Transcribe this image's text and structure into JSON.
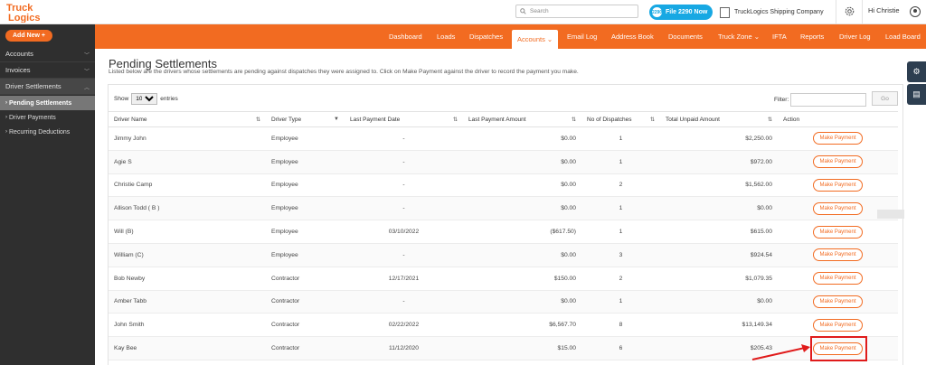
{
  "topbar": {
    "logo_line1": "Truck",
    "logo_line2": "Logics",
    "search_placeholder": "Search",
    "file2290_badge": "2290",
    "file2290_label": "File 2290 Now",
    "company": "TruckLogics Shipping Company",
    "greeting": "Hi Christie"
  },
  "sidebar": {
    "add_new": "Add New +",
    "items": [
      {
        "label": "Accounts",
        "chev": "﹀"
      },
      {
        "label": "Invoices",
        "chev": "﹀"
      },
      {
        "label": "Driver Settlements",
        "chev": "︿"
      }
    ],
    "sub_items": [
      {
        "label": "Pending Settlements"
      },
      {
        "label": "Driver Payments"
      },
      {
        "label": "Recurring Deductions"
      }
    ]
  },
  "nav": {
    "items": [
      "Dashboard",
      "Loads",
      "Dispatches",
      "Accounts ⌄",
      "Email Log",
      "Address Book",
      "Documents",
      "Truck Zone ⌄",
      "IFTA",
      "Reports",
      "Driver Log",
      "Load Board"
    ],
    "active_index": 3
  },
  "page": {
    "title": "Pending Settlements",
    "description": "Listed below are the drivers whose settlements are pending against dispatches they were assigned to. Click on Make Payment against the driver to record the payment you make."
  },
  "table_controls": {
    "show_label": "Show",
    "entries_value": "10",
    "entries_label": "entries",
    "filter_label": "Filter:",
    "go_label": "Go"
  },
  "table": {
    "columns": [
      "Driver Name",
      "Driver Type",
      "Last Payment Date",
      "Last Payment Amount",
      "No of Dispatches",
      "Total Unpaid Amount",
      "Action"
    ],
    "action_label": "Make Payment",
    "rows": [
      {
        "name": "Jimmy John",
        "type": "Employee",
        "date": "-",
        "amount": "$0.00",
        "dispatches": "1",
        "unpaid": "$2,250.00"
      },
      {
        "name": "Agie S",
        "type": "Employee",
        "date": "-",
        "amount": "$0.00",
        "dispatches": "1",
        "unpaid": "$972.00"
      },
      {
        "name": "Christie Camp",
        "type": "Employee",
        "date": "-",
        "amount": "$0.00",
        "dispatches": "2",
        "unpaid": "$1,562.00"
      },
      {
        "name": "Allison Todd ( B )",
        "type": "Employee",
        "date": "-",
        "amount": "$0.00",
        "dispatches": "1",
        "unpaid": "$0.00"
      },
      {
        "name": "Will (B)",
        "type": "Employee",
        "date": "03/10/2022",
        "amount": "($617.50)",
        "dispatches": "1",
        "unpaid": "$615.00"
      },
      {
        "name": "William (C)",
        "type": "Employee",
        "date": "-",
        "amount": "$0.00",
        "dispatches": "3",
        "unpaid": "$924.54"
      },
      {
        "name": "Bob Newby",
        "type": "Contractor",
        "date": "12/17/2021",
        "amount": "$150.00",
        "dispatches": "2",
        "unpaid": "$1,079.35"
      },
      {
        "name": "Amber Tabb",
        "type": "Contractor",
        "date": "-",
        "amount": "$0.00",
        "dispatches": "1",
        "unpaid": "$0.00"
      },
      {
        "name": "John Smith",
        "type": "Contractor",
        "date": "02/22/2022",
        "amount": "$6,567.70",
        "dispatches": "8",
        "unpaid": "$13,149.34"
      },
      {
        "name": "Kay Bee",
        "type": "Contractor",
        "date": "11/12/2020",
        "amount": "$15.00",
        "dispatches": "6",
        "unpaid": "$205.43"
      }
    ]
  },
  "colors": {
    "brand": "#f26b21",
    "sidebar_bg": "#2f2f2f",
    "highlight": "#e01b1b",
    "badge": "#17a8e3"
  }
}
